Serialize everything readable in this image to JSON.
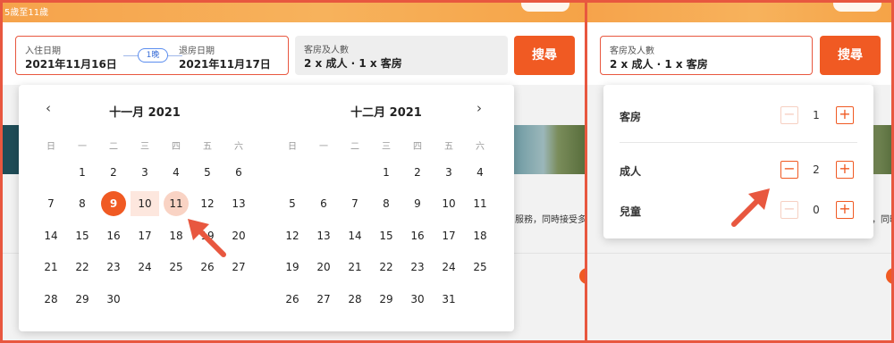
{
  "header": {
    "crumb": "5歲至11歲"
  },
  "search": {
    "checkin_label": "入住日期",
    "checkin_value": "2021年11月16日",
    "nights": "1晚",
    "checkout_label": "退房日期",
    "checkout_value": "2021年11月17日",
    "guests_label": "客房及人數",
    "guests_value": "2 x 成人 · 1 x 客房",
    "button": "搜尋"
  },
  "background": {
    "left_text": "服務，同時接受多種",
    "right_text": "，同時接受多"
  },
  "calendar": {
    "prev_icon": "chevron-left-icon",
    "next_icon": "chevron-right-icon",
    "weekdays": [
      "日",
      "一",
      "二",
      "三",
      "四",
      "五",
      "六"
    ],
    "months": [
      {
        "title": "十一月 2021",
        "days": [
          "1",
          "2",
          "3",
          "4",
          "5",
          "6",
          "7",
          "8",
          "9",
          "10",
          "11",
          "12",
          "13",
          "14",
          "15",
          "16",
          "17",
          "18",
          "19",
          "20",
          "21",
          "22",
          "23",
          "24",
          "25",
          "26",
          "27",
          "28",
          "29",
          "30"
        ]
      },
      {
        "title": "十二月 2021",
        "days": [
          "1",
          "2",
          "3",
          "4",
          "5",
          "6",
          "7",
          "8",
          "9",
          "10",
          "11",
          "12",
          "13",
          "14",
          "15",
          "16",
          "17",
          "18",
          "19",
          "20",
          "21",
          "22",
          "23",
          "24",
          "25",
          "26",
          "27",
          "28",
          "29",
          "30",
          "31"
        ]
      }
    ],
    "selected_start": "9",
    "selected_end": "11"
  },
  "guests_popup": {
    "rooms": {
      "label": "客房",
      "value": "1",
      "minus": "−",
      "plus": "+"
    },
    "adults": {
      "label": "成人",
      "value": "2",
      "minus": "−",
      "plus": "+"
    },
    "children": {
      "label": "兒童",
      "value": "0",
      "minus": "−",
      "plus": "+"
    }
  },
  "colors": {
    "accent": "#f05a23",
    "annotation": "#e8573f"
  }
}
